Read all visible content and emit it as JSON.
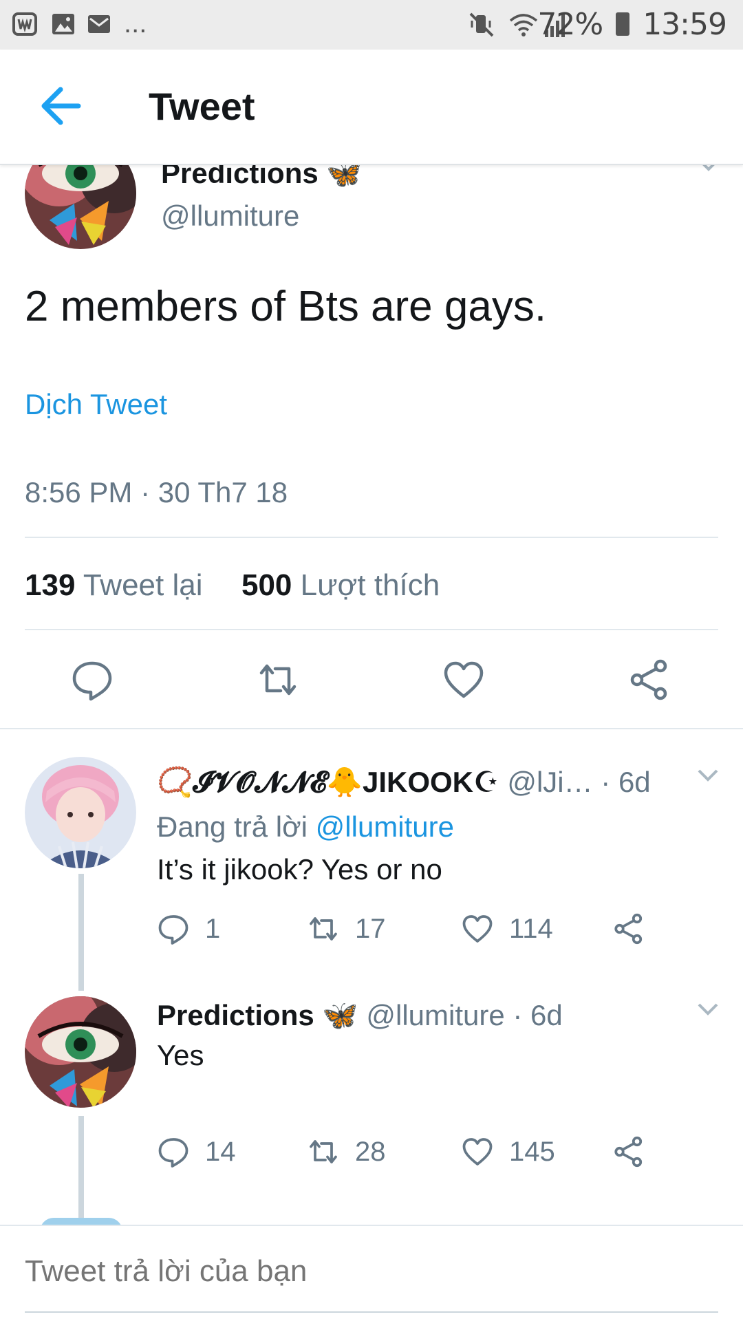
{
  "status_bar": {
    "battery": "72%",
    "time": "13:59",
    "more": "...",
    "icons": [
      "widget-icon",
      "image-icon",
      "mail-icon",
      "mute-icon",
      "wifi-icon",
      "signal-icon",
      "battery-icon"
    ]
  },
  "header": {
    "title": "Tweet",
    "back_icon": "back-arrow-icon"
  },
  "main_tweet": {
    "author_name": "Predictions 🦋",
    "handle": "@llumiture",
    "text": "2 members of Bts are gays.",
    "translate_label": "Dịch Tweet",
    "timestamp": "8:56 PM · 30 Th7 18",
    "retweet_count": "139",
    "retweet_label": "Tweet lại",
    "like_count": "500",
    "like_label": "Lượt thích",
    "actions": [
      "reply-icon",
      "retweet-icon",
      "like-icon",
      "share-icon"
    ]
  },
  "replies": [
    {
      "author_name": "📿𝓘𝓥𝓞𝓝𝓝𝓔🐥JIKOOK☪",
      "handle_time": "@lJi… · 6d",
      "replying_prefix": "Đang trả lời",
      "replying_to": "@llumiture",
      "text": "It’s it jikook? Yes or no",
      "reply_count": "1",
      "retweet_count": "17",
      "like_count": "114"
    },
    {
      "author_name": "Predictions 🦋",
      "handle_time": "@llumiture · 6d",
      "text": "Yes",
      "reply_count": "14",
      "retweet_count": "28",
      "like_count": "145"
    }
  ],
  "compose": {
    "placeholder": "Tweet trả lời của bạn"
  },
  "colors": {
    "accent": "#1b95e0",
    "muted": "#657786",
    "divider": "#e1e8ed"
  }
}
